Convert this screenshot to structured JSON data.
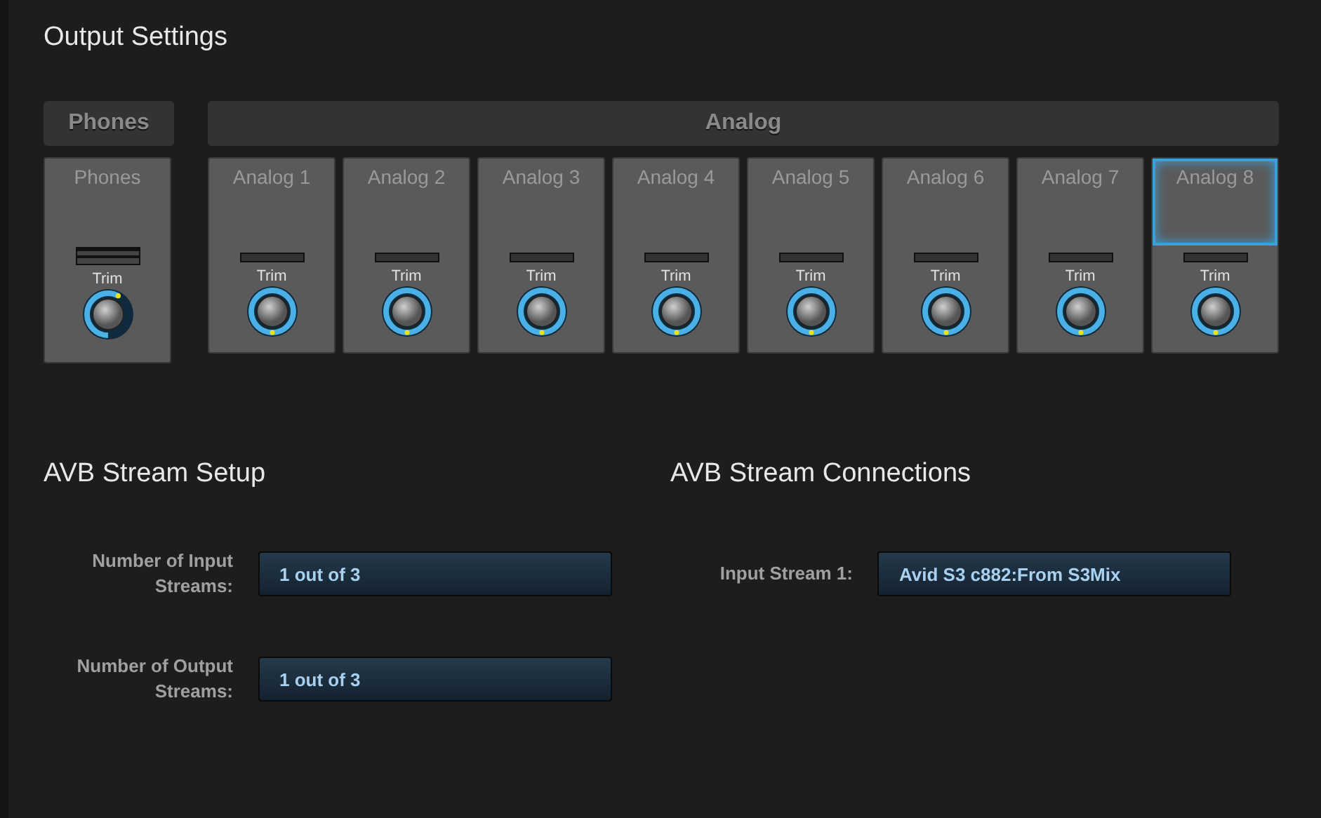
{
  "title": "Output Settings",
  "groups": [
    {
      "label": "Phones",
      "strips": [
        {
          "name": "Phones",
          "kind": "stereo",
          "knob_label": "Trim",
          "level": 0.58,
          "selected": false
        }
      ]
    },
    {
      "label": "Analog",
      "strips": [
        {
          "name": "Analog 1",
          "kind": "mono",
          "knob_label": "Trim",
          "level": 1,
          "selected": false
        },
        {
          "name": "Analog 2",
          "kind": "mono",
          "knob_label": "Trim",
          "level": 1,
          "selected": false
        },
        {
          "name": "Analog 3",
          "kind": "mono",
          "knob_label": "Trim",
          "level": 1,
          "selected": false
        },
        {
          "name": "Analog 4",
          "kind": "mono",
          "knob_label": "Trim",
          "level": 1,
          "selected": false
        },
        {
          "name": "Analog 5",
          "kind": "mono",
          "knob_label": "Trim",
          "level": 1,
          "selected": false
        },
        {
          "name": "Analog 6",
          "kind": "mono",
          "knob_label": "Trim",
          "level": 1,
          "selected": false
        },
        {
          "name": "Analog 7",
          "kind": "mono",
          "knob_label": "Trim",
          "level": 1,
          "selected": false
        },
        {
          "name": "Analog 8",
          "kind": "mono",
          "knob_label": "Trim",
          "level": 1,
          "selected": true
        }
      ]
    }
  ],
  "setup": {
    "title": "AVB Stream Setup",
    "fields": [
      {
        "label": "Number of Input Streams:",
        "value": "1 out of 3"
      },
      {
        "label": "Number of Output Streams:",
        "value": "1 out of 3"
      }
    ]
  },
  "connections": {
    "title": "AVB Stream Connections",
    "fields": [
      {
        "label": "Input Stream 1:",
        "value": "Avid S3 c882:From S3Mix"
      }
    ]
  }
}
